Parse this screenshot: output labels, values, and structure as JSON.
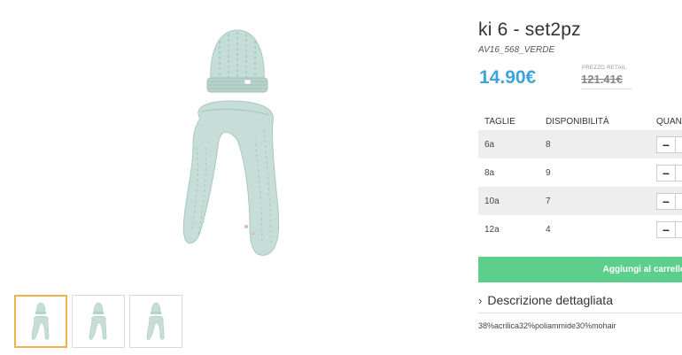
{
  "product": {
    "title": "ki 6 - set2pz",
    "sku": "AV16_568_VERDE",
    "price": "14.90€",
    "retail_label": "PREZZO RETAIL",
    "retail_price": "121.41€"
  },
  "table": {
    "headers": [
      "TAGLIE",
      "DISPONIBILITÀ",
      "QUAN"
    ],
    "rows": [
      {
        "size": "6a",
        "availability": "8"
      },
      {
        "size": "8a",
        "availability": "9"
      },
      {
        "size": "10a",
        "availability": "7"
      },
      {
        "size": "12a",
        "availability": "4"
      }
    ],
    "minus_label": "−"
  },
  "cart_button": "Aggiungi al carrello",
  "description": {
    "heading": "Descrizione dettagliata",
    "chevron": "›",
    "body": "38%acrilica32%poliammide30%mohair"
  },
  "colors": {
    "price": "#3ea4dc",
    "cart": "#5dcf8c",
    "thumb_active": "#f0b24a",
    "knit": "#bfd9d3"
  },
  "images": {
    "main": "hat-and-scarf-set",
    "thumbnails": [
      "thumbnail-1",
      "thumbnail-2",
      "thumbnail-3"
    ]
  }
}
